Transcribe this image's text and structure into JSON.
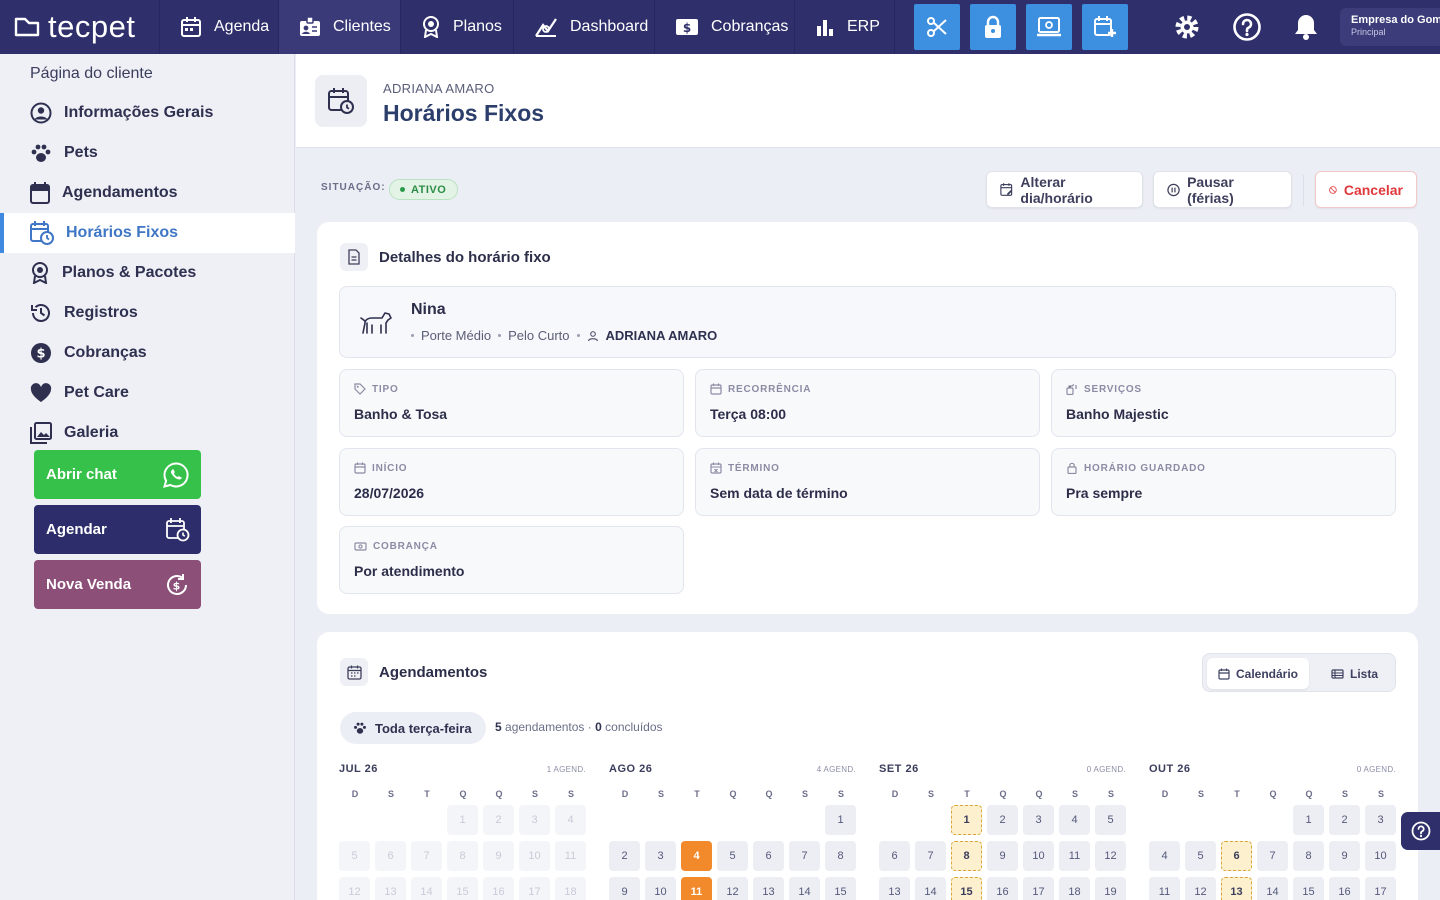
{
  "brand": {
    "name": "tecpet"
  },
  "nav": [
    {
      "label": "Agenda",
      "icon": "calendar-icon"
    },
    {
      "label": "Clientes",
      "icon": "id-badge-icon"
    },
    {
      "label": "Planos",
      "icon": "award-icon"
    },
    {
      "label": "Dashboard",
      "icon": "chart-line-icon"
    },
    {
      "label": "Cobranças",
      "icon": "dollar-icon"
    },
    {
      "label": "ERP",
      "icon": "bar-chart-icon"
    }
  ],
  "toolbar_icons": [
    "scissors-icon",
    "lock-icon",
    "pos-terminal-icon",
    "calendar-plus-icon",
    "gear-icon",
    "help-icon",
    "bell-icon"
  ],
  "company": {
    "name": "Empresa do Gomes",
    "subtitle": "Principal"
  },
  "sidebar": {
    "title": "Página do cliente",
    "items": [
      {
        "label": "Informações Gerais",
        "icon": "user-circle-icon"
      },
      {
        "label": "Pets",
        "icon": "paw-icon"
      },
      {
        "label": "Agendamentos",
        "icon": "calendar-icon"
      },
      {
        "label": "Horários Fixos",
        "icon": "calendar-clock-icon"
      },
      {
        "label": "Planos & Pacotes",
        "icon": "award-icon"
      },
      {
        "label": "Registros",
        "icon": "history-icon"
      },
      {
        "label": "Cobranças",
        "icon": "dollar-circle-icon"
      },
      {
        "label": "Pet Care",
        "icon": "heart-icon"
      },
      {
        "label": "Galeria",
        "icon": "gallery-icon"
      }
    ],
    "active_index": 3,
    "actions": [
      {
        "label": "Abrir chat",
        "icon": "whatsapp-icon",
        "color": "#36c24a"
      },
      {
        "label": "Agendar",
        "icon": "calendar-clock-icon",
        "color": "#2d2d6b"
      },
      {
        "label": "Nova Venda",
        "icon": "dollar-refresh-icon",
        "color": "#8b4f78"
      }
    ]
  },
  "header": {
    "client": "ADRIANA AMARO",
    "title": "Horários Fixos"
  },
  "status": {
    "label": "SITUAÇÃO:",
    "value": "ATIVO"
  },
  "buttons": {
    "change": "Alterar dia/horário",
    "pause": "Pausar (férias)",
    "cancel": "Cancelar"
  },
  "details": {
    "title": "Detalhes do horário fixo",
    "pet": {
      "name": "Nina",
      "size": "Porte Médio",
      "coat": "Pelo Curto",
      "owner": "ADRIANA AMARO"
    },
    "fields": [
      {
        "label": "TIPO",
        "value": "Banho & Tosa",
        "icon": "tag-icon"
      },
      {
        "label": "RECORRÊNCIA",
        "value": "Terça 08:00",
        "icon": "calendar-repeat-icon"
      },
      {
        "label": "SERVIÇOS",
        "value": "Banho Majestic",
        "icon": "spray-icon"
      },
      {
        "label": "INÍCIO",
        "value": "28/07/2026",
        "icon": "calendar-icon"
      },
      {
        "label": "TÉRMINO",
        "value": "Sem data de término",
        "icon": "calendar-x-icon"
      },
      {
        "label": "HORÁRIO GUARDADO",
        "value": "Pra sempre",
        "icon": "lock-icon"
      },
      {
        "label": "COBRANÇA",
        "value": "Por atendimento",
        "icon": "cash-icon"
      }
    ]
  },
  "appointments": {
    "title": "Agendamentos",
    "view_calendar": "Calendário",
    "view_list": "Lista",
    "recurrence_pill": "Toda terça-feira",
    "count_total": "5",
    "count_total_label": "agendamentos ·",
    "count_done": "0",
    "count_done_label": "concluídos",
    "weekdays": [
      "D",
      "S",
      "T",
      "Q",
      "Q",
      "S",
      "S"
    ],
    "months": [
      {
        "name": "JUL 26",
        "count": "1 AGEND.",
        "offset": 3,
        "days": 18,
        "dim_until": 18,
        "sched": [],
        "pend": []
      },
      {
        "name": "AGO 26",
        "count": "4 AGEND.",
        "offset": 6,
        "days": 15,
        "dim_until": 0,
        "sched": [
          4,
          11
        ],
        "pend": []
      },
      {
        "name": "SET 26",
        "count": "0 AGEND.",
        "offset": 2,
        "days": 19,
        "dim_until": 0,
        "sched": [],
        "pend": [
          1,
          8,
          15
        ]
      },
      {
        "name": "OUT 26",
        "count": "0 AGEND.",
        "offset": 4,
        "days": 17,
        "dim_until": 0,
        "sched": [],
        "pend": [
          6,
          13
        ]
      }
    ]
  },
  "colors": {
    "nav": "#2f2f6b",
    "accent": "#3d8fe0",
    "scheduled": "#f2892b",
    "pending": "#fdf0cf"
  }
}
